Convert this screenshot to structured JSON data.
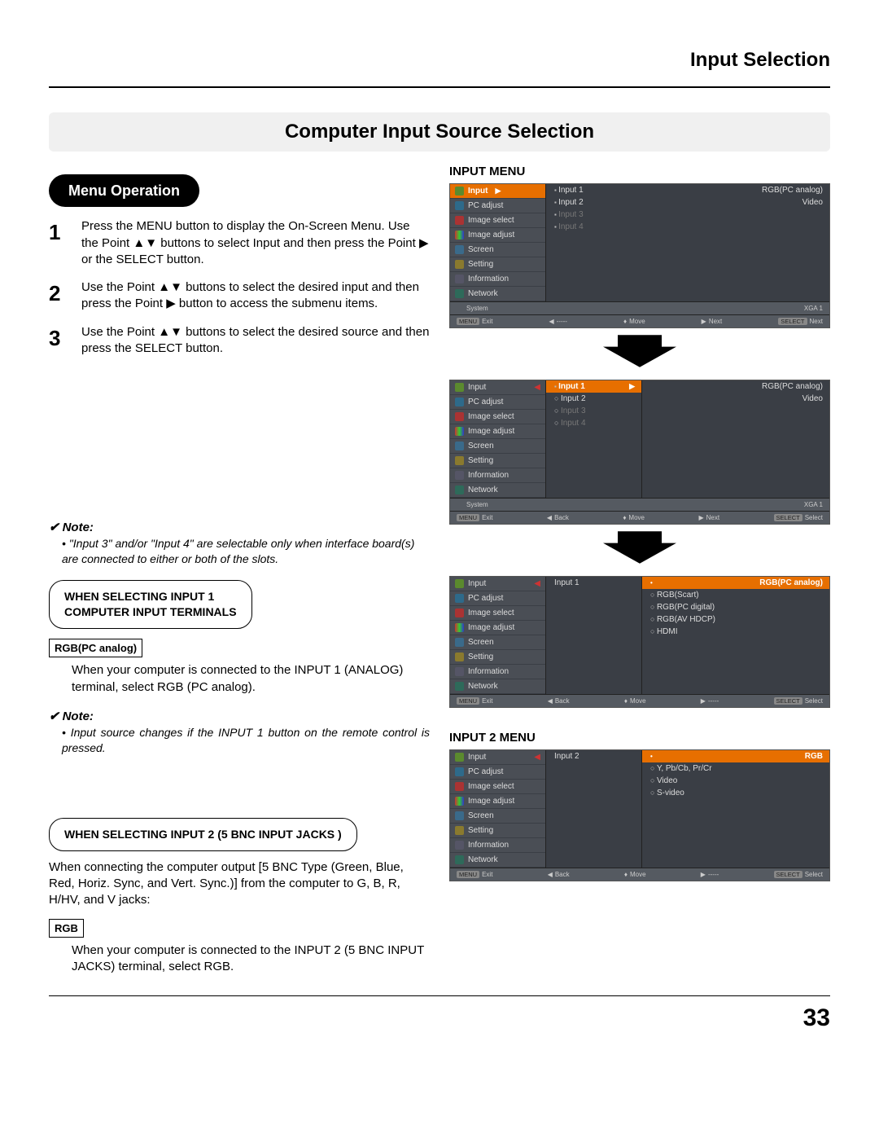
{
  "page": {
    "header": "Input Selection",
    "section_title": "Computer Input Source Selection",
    "subheader": "Menu Operation",
    "number": "33"
  },
  "steps": {
    "s1": "Press the MENU button to display the On-Screen Menu. Use the Point ▲▼ buttons to select Input and then press the Point ▶ or the SELECT button.",
    "s2": "Use the Point ▲▼ buttons to select the desired input and then press the Point ▶ button to access the submenu items.",
    "s3": "Use the Point ▲▼ buttons to select the desired source and then press the SELECT button."
  },
  "notes": {
    "n1_h": "Note:",
    "n1_b": "\"Input 3\" and/or \"Input 4\" are selectable only when interface board(s) are connected to either or both of the slots.",
    "n2_h": "Note:",
    "n2_b": "Input source changes if the INPUT 1 button on the remote control is pressed."
  },
  "callouts": {
    "c1_line1": "WHEN SELECTING INPUT 1",
    "c1_line2": "COMPUTER INPUT TERMINALS ",
    "c2": "WHEN SELECTING INPUT 2 (5 BNC INPUT JACKS )"
  },
  "tags": {
    "rgbpc": "RGB(PC analog)",
    "rgb": "RGB"
  },
  "body": {
    "rgbpc": "When your computer is connected to the INPUT 1 (ANALOG) terminal, select RGB (PC analog).",
    "bnc_intro": "When connecting the computer output [5 BNC Type (Green, Blue, Red, Horiz. Sync, and Vert. Sync.)] from the computer to G, B, R, H/HV, and V jacks:",
    "rgb": "When your computer is connected to the INPUT 2 (5 BNC INPUT JACKS) terminal, select RGB."
  },
  "right_titles": {
    "t1": "INPUT MENU",
    "t2": "INPUT 2 MENU"
  },
  "osd": {
    "side": {
      "input": "Input",
      "pcadjust": "PC adjust",
      "imgselect": "Image select",
      "imgadjust": "Image adjust",
      "screen": "Screen",
      "setting": "Setting",
      "information": "Information",
      "network": "Network"
    },
    "inputs": {
      "i1": "Input 1",
      "i2": "Input 2",
      "i3": "Input 3",
      "i4": "Input 4"
    },
    "detail1": {
      "rgb_analog": "RGB(PC analog)",
      "video": "Video"
    },
    "detail_sources_input1": {
      "a": "RGB(PC analog)",
      "b": "RGB(Scart)",
      "c": "RGB(PC digital)",
      "d": "RGB(AV HDCP)",
      "e": "HDMI"
    },
    "detail_sources_input2": {
      "a": "RGB",
      "b": "Y, Pb/Cb, Pr/Cr",
      "c": "Video",
      "d": "S-video"
    },
    "sys": {
      "label": "System",
      "value": "XGA 1"
    },
    "foot": {
      "menu": "MENU",
      "exit": "Exit",
      "back": "Back",
      "dashes": "-----",
      "move": "Move",
      "next": "Next",
      "select": "SELECT",
      "select_w": "Select"
    }
  }
}
